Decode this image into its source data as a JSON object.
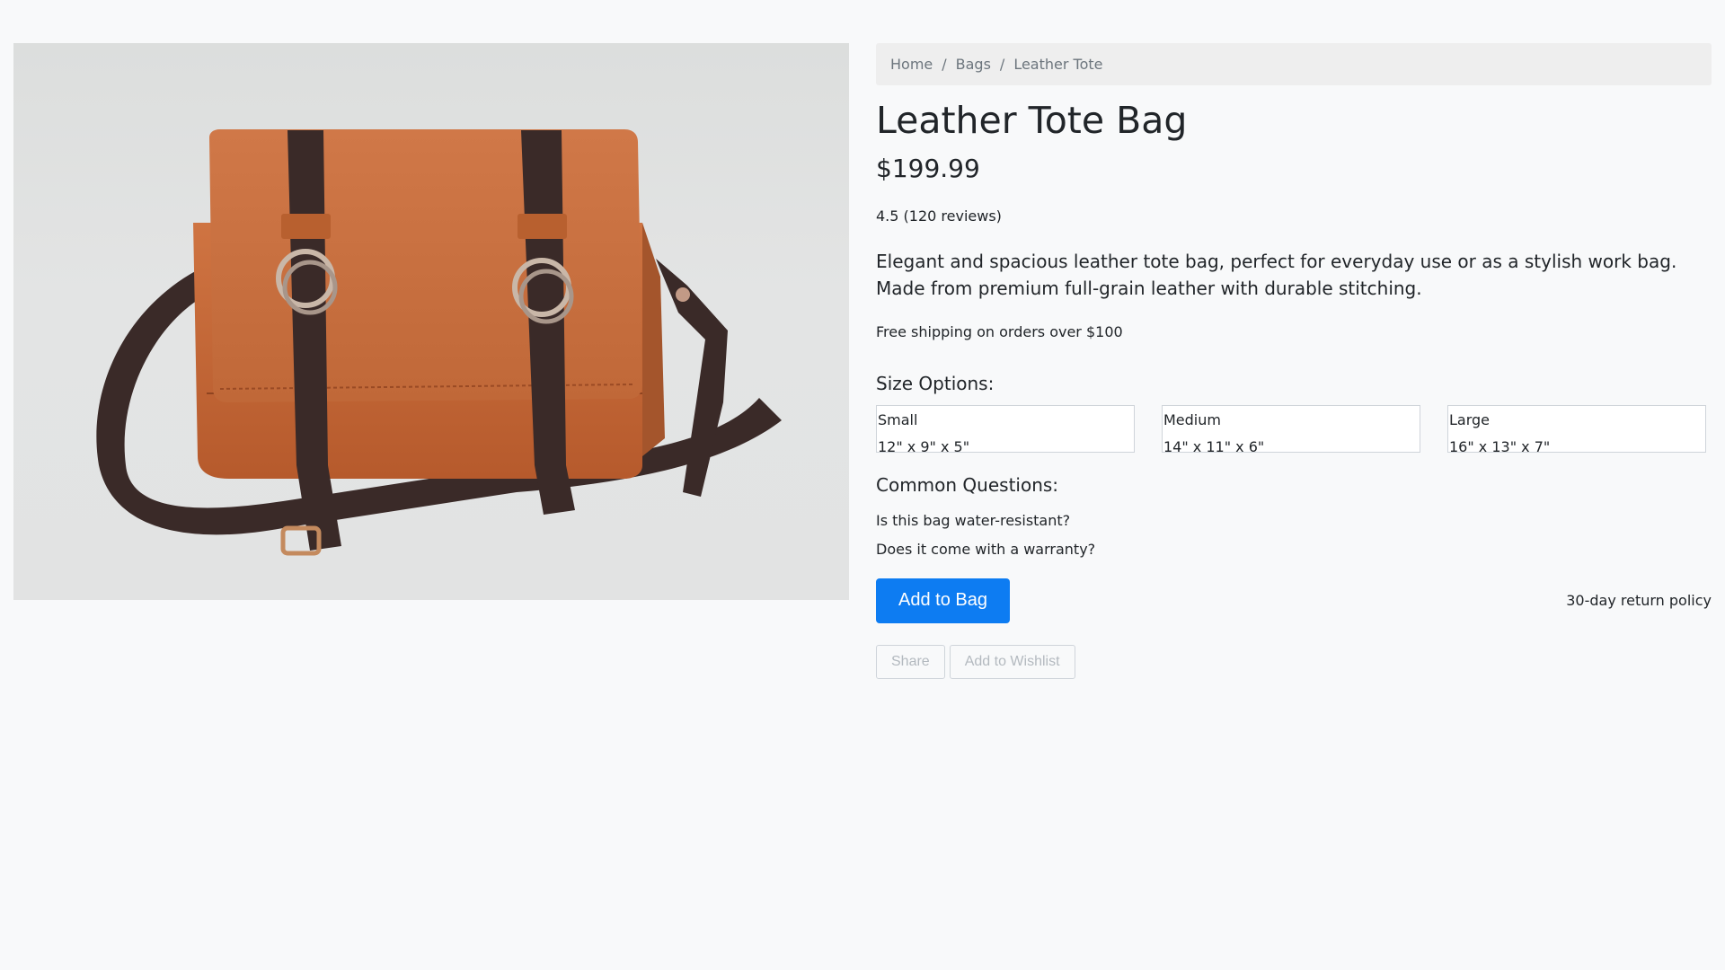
{
  "breadcrumb": {
    "items": [
      "Home",
      "Bags",
      "Leather Tote"
    ],
    "separator": "/"
  },
  "product": {
    "title": "Leather Tote Bag",
    "price": "$199.99",
    "rating": "4.5 (120 reviews)",
    "description": "Elegant and spacious leather tote bag, perfect for everyday use or as a stylish work bag. Made from premium full-grain leather with durable stitching.",
    "shipping": "Free shipping on orders over $100",
    "image_icon": "leather-bag-photo"
  },
  "sizes": {
    "heading": "Size Options:",
    "options": [
      {
        "name": "Small",
        "dimensions": "12\" x 9\" x 5\""
      },
      {
        "name": "Medium",
        "dimensions": "14\" x 11\" x 6\""
      },
      {
        "name": "Large",
        "dimensions": "16\" x 13\" x 7\""
      }
    ]
  },
  "faq": {
    "heading": "Common Questions:",
    "questions": [
      "Is this bag water-resistant?",
      "Does it come with a warranty?"
    ]
  },
  "actions": {
    "add_to_bag": "Add to Bag",
    "return_policy": "30-day return policy",
    "share": "Share",
    "wishlist": "Add to Wishlist"
  },
  "colors": {
    "primary": "#0d7cf2",
    "background": "#f8f9fa",
    "breadcrumb_bg": "#eeeeee",
    "leather": "#c2683a",
    "strap": "#3a2a28"
  }
}
